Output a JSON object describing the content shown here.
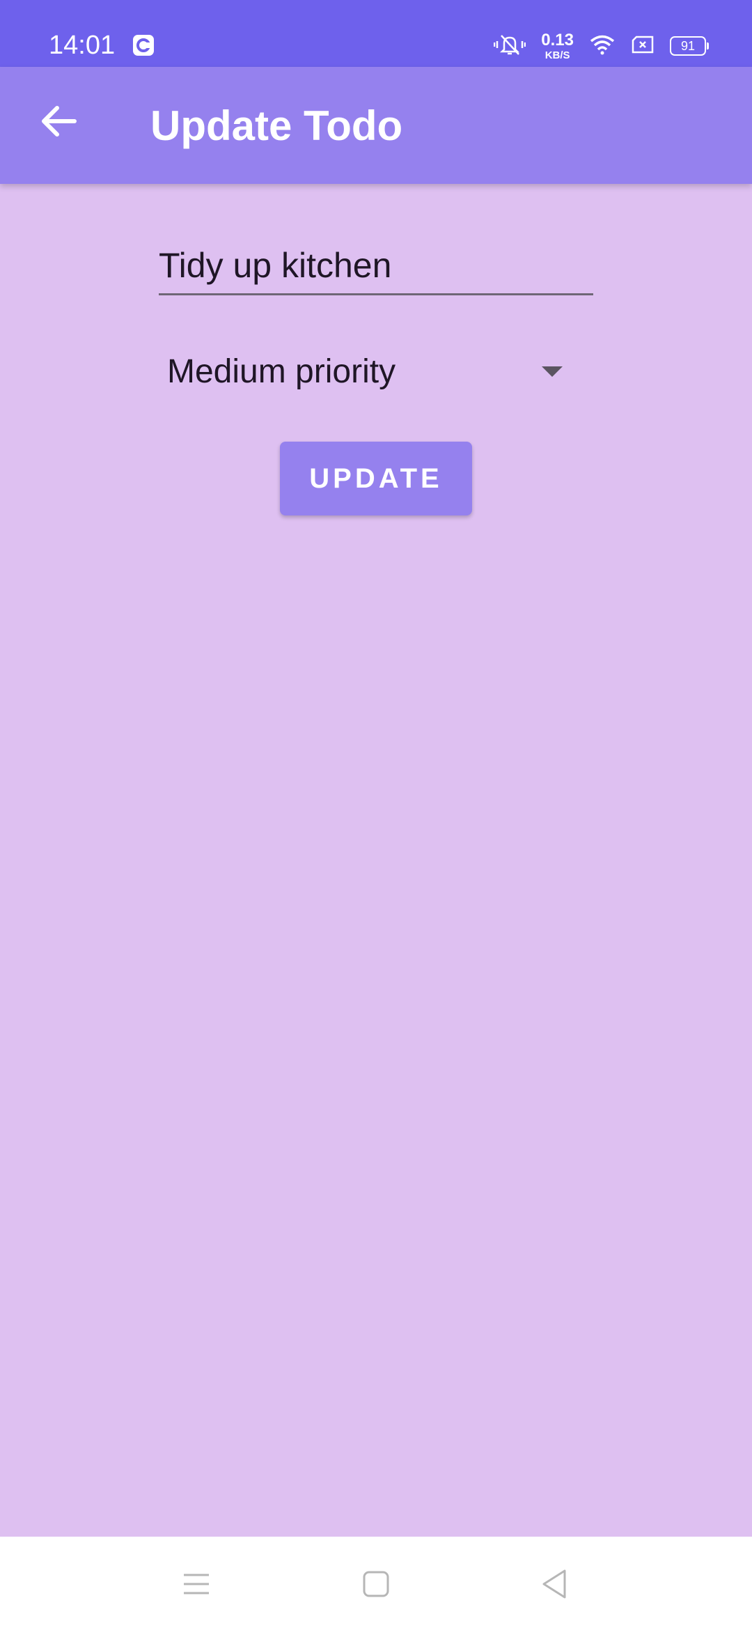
{
  "status_bar": {
    "time": "14:01",
    "net_speed_value": "0.13",
    "net_speed_unit": "KB/S",
    "battery": "91",
    "icons": [
      "app-notification-icon",
      "vibrate-mute-icon",
      "wifi-icon",
      "sim-icon",
      "battery-icon"
    ]
  },
  "app_bar": {
    "title": "Update Todo",
    "back_icon": "arrow-back-icon"
  },
  "form": {
    "todo_value": "Tidy up kitchen",
    "priority_value": "Medium priority",
    "update_label": "UPDATE"
  },
  "nav_bar": {
    "icons": [
      "menu-icon",
      "home-icon",
      "back-icon"
    ]
  },
  "colors": {
    "status_bar": "#6e61ec",
    "app_bar": "#9581ee",
    "background": "#dec0f1",
    "button": "#9581ee",
    "nav_bar": "#ffffff"
  }
}
